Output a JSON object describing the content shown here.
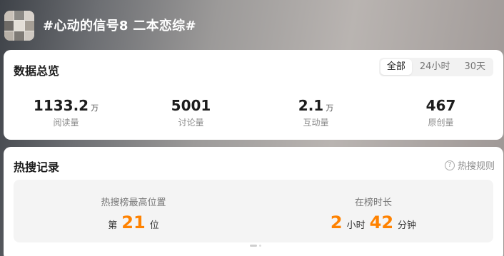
{
  "header": {
    "topic_title": "#心动的信号8 二本恋综#"
  },
  "overview": {
    "title": "数据总览",
    "tabs": [
      {
        "label": "全部",
        "active": true
      },
      {
        "label": "24小时",
        "active": false
      },
      {
        "label": "30天",
        "active": false
      }
    ],
    "stats": [
      {
        "value": "1133.2",
        "unit": "万",
        "label": "阅读量"
      },
      {
        "value": "5001",
        "unit": "",
        "label": "讨论量"
      },
      {
        "value": "2.1",
        "unit": "万",
        "label": "互动量"
      },
      {
        "value": "467",
        "unit": "",
        "label": "原创量"
      }
    ]
  },
  "hot_search": {
    "title": "热搜记录",
    "rules_label": "热搜规则",
    "peak": {
      "label": "热搜榜最高位置",
      "prefix": "第",
      "value": "21",
      "suffix": "位"
    },
    "duration": {
      "label": "在榜时长",
      "hours": "2",
      "hours_unit": "小时",
      "minutes": "42",
      "minutes_unit": "分钟"
    }
  },
  "colors": {
    "accent": "#ff8200",
    "card_bg": "#ffffff",
    "muted_text": "#8c8c8c"
  },
  "icons": {
    "rules": "question-circle-icon",
    "avatar": "topic-avatar-image"
  }
}
